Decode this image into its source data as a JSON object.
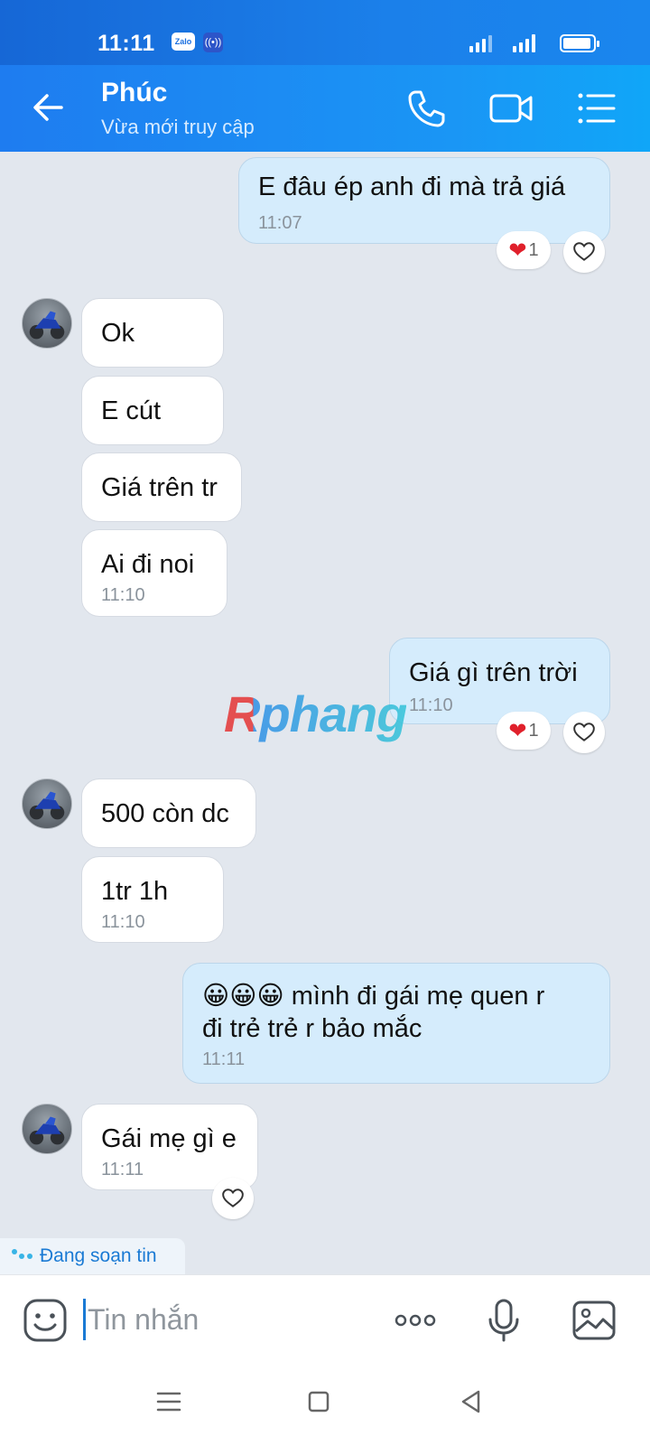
{
  "status_bar": {
    "time": "11:11",
    "zalo_badge": "Zalo"
  },
  "header": {
    "contact_name": "Phúc",
    "contact_status": "Vừa mới truy cập"
  },
  "messages": [
    {
      "text": "E đâu ép anh đi mà trả giá",
      "time": "11:07",
      "reaction_count": "1"
    },
    {
      "text": "Ok"
    },
    {
      "text": "E cút"
    },
    {
      "text": "Giá trên tr"
    },
    {
      "text": "Ai đi noi",
      "time": "11:10"
    },
    {
      "text": "Giá gì trên trời",
      "time": "11:10",
      "reaction_count": "1"
    },
    {
      "text": "500 còn dc"
    },
    {
      "text": "1tr 1h",
      "time": "11:10"
    },
    {
      "emoji": "😀😀😀",
      "text": " mình đi gái mẹ quen r",
      "text2": "đi trẻ trẻ r bảo mắc",
      "time": "11:11"
    },
    {
      "text": "Gái mẹ gì e",
      "time": "11:11"
    }
  ],
  "typing_indicator": "Đang soạn tin",
  "watermark": "Rphang",
  "input": {
    "placeholder": "Tin nhắn"
  },
  "colors": {
    "header": "#1a96f5",
    "outgoing_bubble": "#d5ecfc",
    "incoming_bubble": "#ffffff",
    "background": "#e2e7ee",
    "reaction_heart": "#e0202b"
  }
}
